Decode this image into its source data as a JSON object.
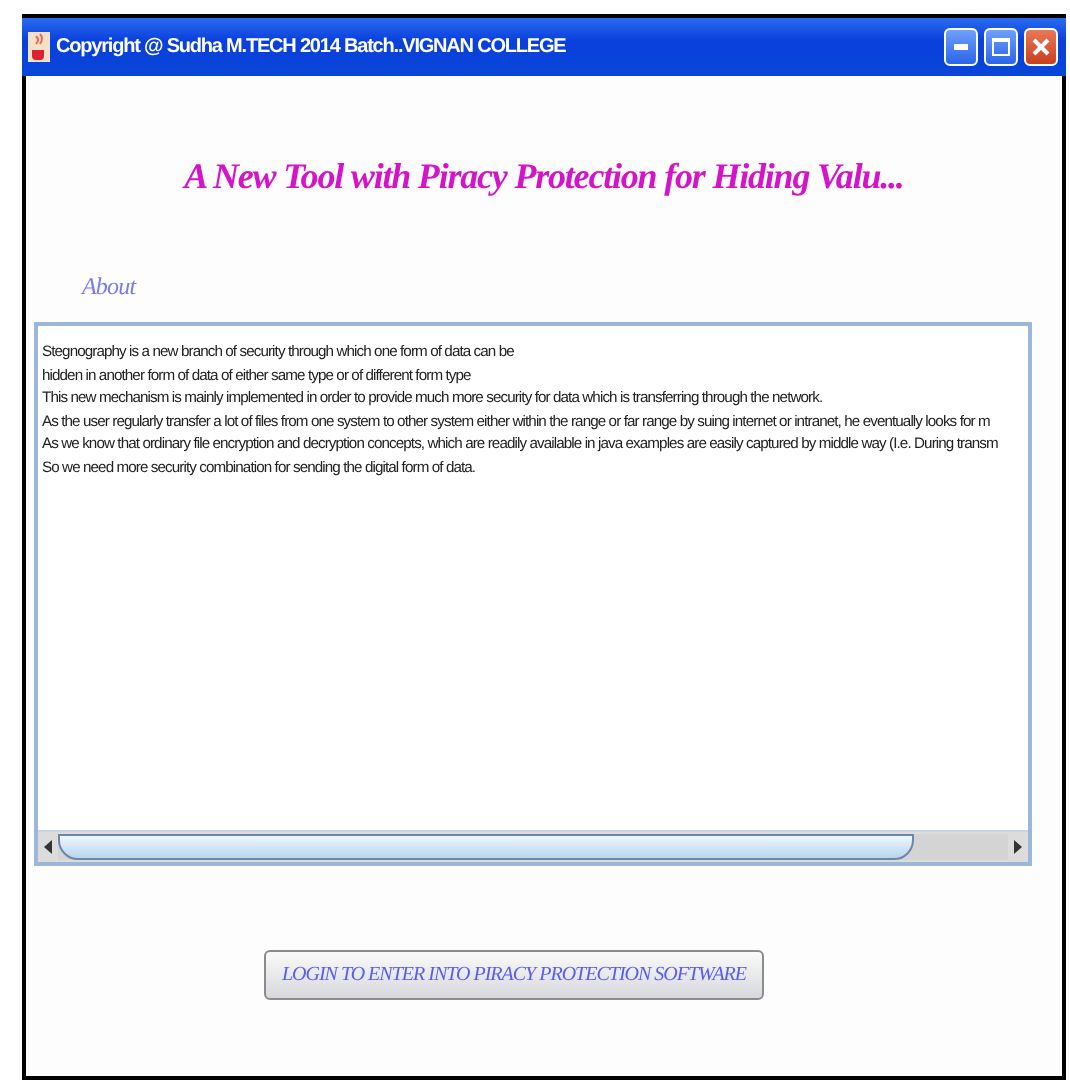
{
  "window": {
    "title": "Copyright @ Sudha M.TECH 2014 Batch..VIGNAN COLLEGE"
  },
  "heading": "A New Tool with Piracy Protection for Hiding Valu...",
  "about_label": "About",
  "text_area": {
    "lines": [
      "Stegnography is a new branch of security through which one form of data can be",
      "hidden in another form of data of either same type or of different form type",
      "This new mechanism is mainly implemented in order to provide much more security for data which is transferring through the network.",
      "As the user regularly transfer a lot of files from one system to other system either within the range or far range by suing internet or intranet, he eventually looks for m",
      "As we know that ordinary file encryption and decryption concepts, which are readily available in java examples are easily captured by middle way (I.e. During transm",
      "So we need more security combination for sending the digital form of data."
    ],
    "level": 0.9
  },
  "login_button": "LOGIN TO ENTER INTO PIRACY PROTECTION SOFTWARE"
}
